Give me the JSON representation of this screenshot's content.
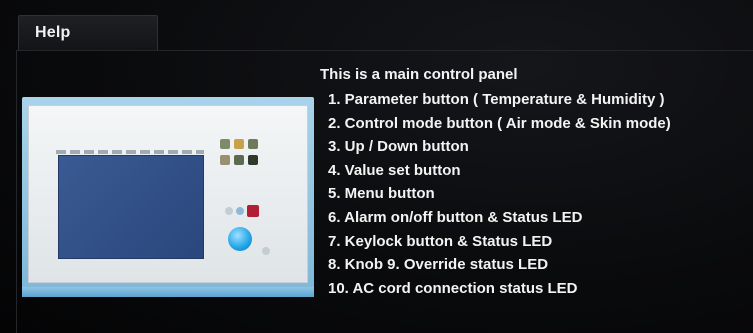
{
  "dialog": {
    "title": "Help"
  },
  "content": {
    "intro": "This is a main control panel",
    "items": [
      "1. Parameter button ( Temperature & Humidity )",
      "2. Control mode button ( Air mode & Skin mode)",
      "3. Up / Down button",
      "4. Value set button",
      "5. Menu button",
      "6. Alarm on/off button & Status LED",
      "7. Keylock button & Status LED",
      "8. Knob  9. Override status LED",
      "10. AC cord connection status LED"
    ]
  },
  "colors": {
    "background": "#0a0b0d",
    "text": "#f3f3f3",
    "panel_frame": "#a9d3ea",
    "device_screen": "#3a5a93",
    "knob": "#1ea3e6",
    "alarm_led": "#b01f34"
  }
}
